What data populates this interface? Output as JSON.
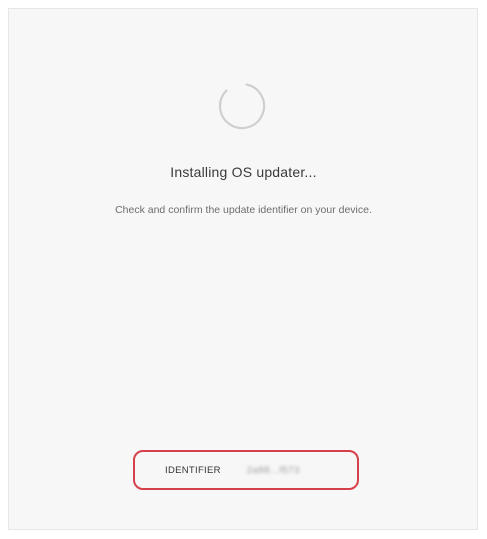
{
  "status": {
    "title": "Installing OS updater...",
    "message": "Check and confirm the update identifier on your device.",
    "spinner_icon": "loading-spinner-icon"
  },
  "identifier": {
    "label": "IDENTIFIER",
    "value": "2a88...f573",
    "highlight_color": "#d6404a"
  },
  "colors": {
    "panel_background": "#f7f7f7",
    "spinner_track": "#d0d0d0"
  }
}
